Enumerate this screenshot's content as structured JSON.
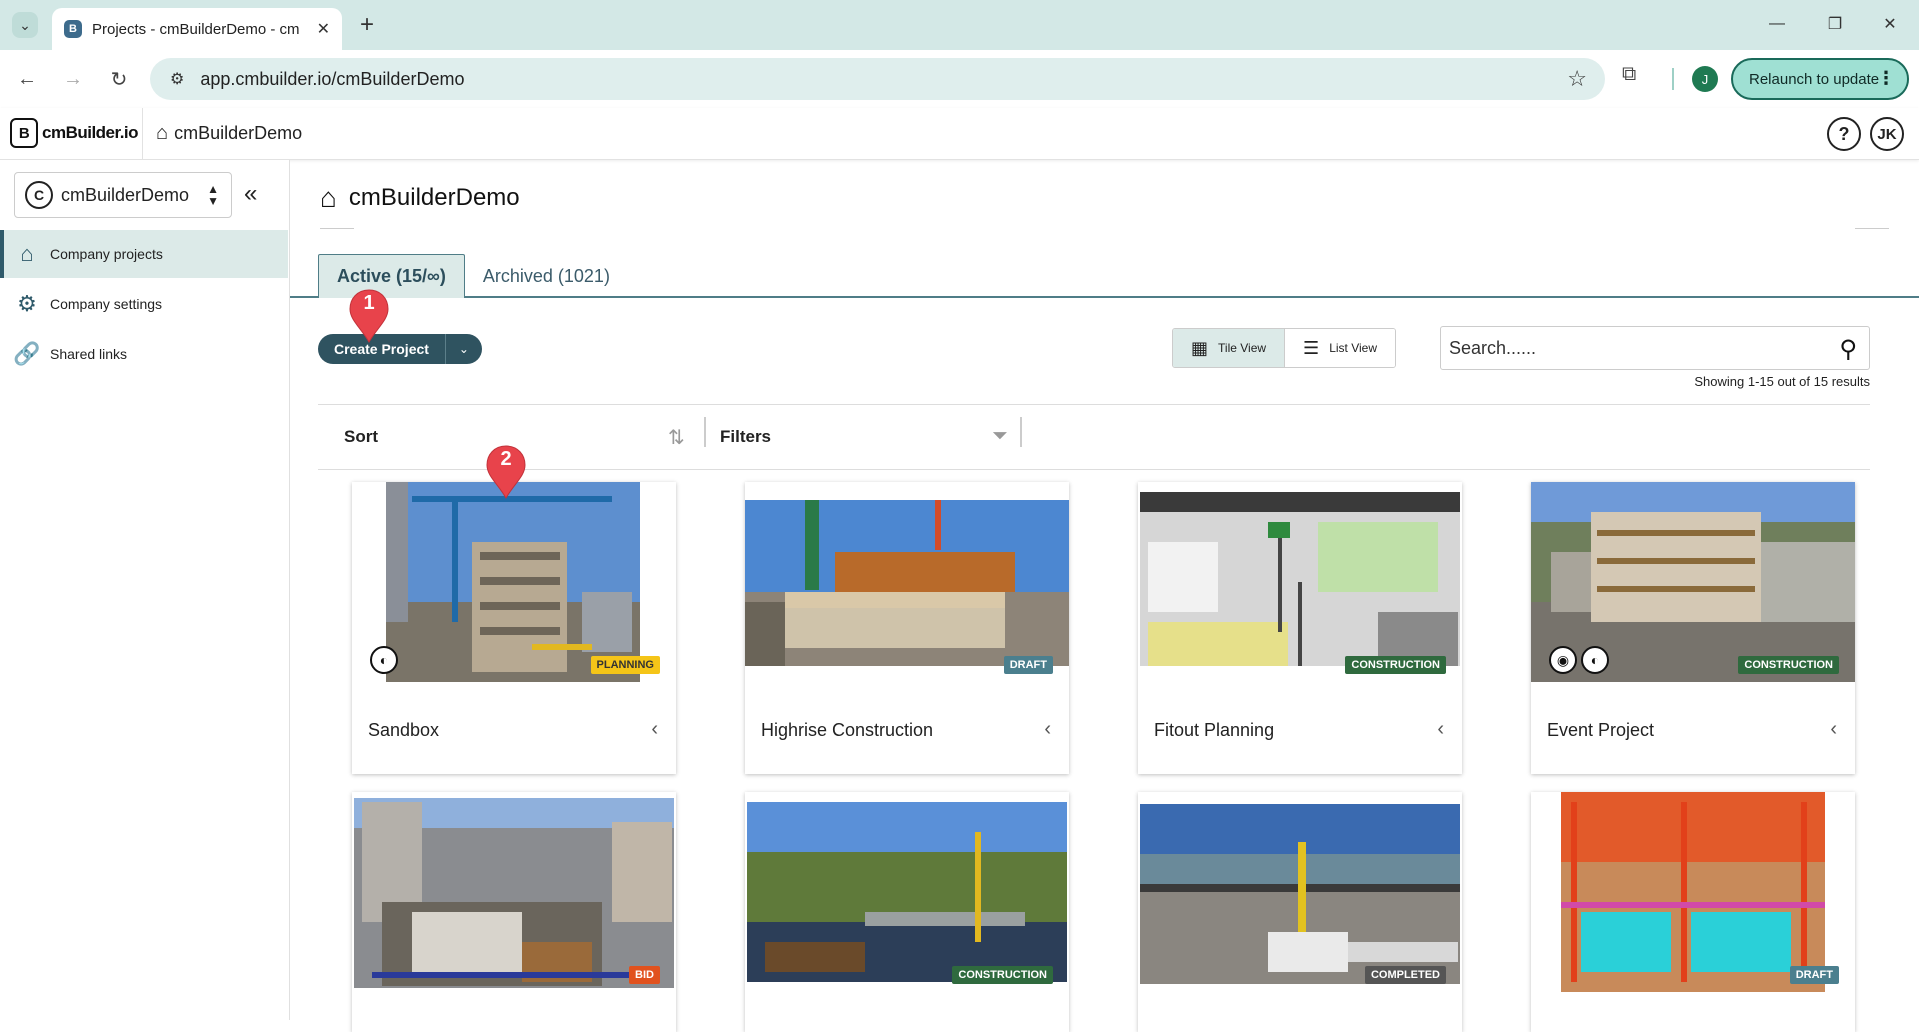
{
  "browser": {
    "tab_title": "Projects - cmBuilderDemo - cm",
    "tab_favicon": "B",
    "url": "app.cmbuilder.io/cmBuilderDemo",
    "profile_initial": "J",
    "relaunch_label": "Relaunch to update"
  },
  "header": {
    "logo_text": "cmBuilder.io",
    "logo_mark": "B",
    "breadcrumb": "cmBuilderDemo",
    "user_initials": "JK",
    "help": "?"
  },
  "sidebar": {
    "org_initial": "C",
    "org_name": "cmBuilderDemo",
    "items": [
      {
        "label": "Company projects",
        "icon": "home-icon",
        "active": true
      },
      {
        "label": "Company settings",
        "icon": "settings-icon",
        "active": false
      },
      {
        "label": "Shared links",
        "icon": "link-icon",
        "active": false
      }
    ]
  },
  "main": {
    "title": "cmBuilderDemo",
    "tabs": [
      {
        "label": "Active (15/∞)",
        "active": true
      },
      {
        "label": "Archived (1021)",
        "active": false
      }
    ],
    "create_button": "Create Project",
    "views": {
      "tile": "Tile View",
      "list": "List View"
    },
    "search_placeholder": "Search......",
    "results_text": "Showing 1-15 out of 15 results",
    "sort_label": "Sort",
    "filters_label": "Filters"
  },
  "projects": [
    {
      "name": "Sandbox",
      "status": "PLANNING"
    },
    {
      "name": "Highrise Construction",
      "status": "DRAFT"
    },
    {
      "name": "Fitout Planning",
      "status": "CONSTRUCTION"
    },
    {
      "name": "Event Project",
      "status": "CONSTRUCTION"
    },
    {
      "name": "",
      "status": "BID"
    },
    {
      "name": "",
      "status": "CONSTRUCTION"
    },
    {
      "name": "",
      "status": "COMPLETED"
    },
    {
      "name": "",
      "status": "DRAFT"
    }
  ],
  "callouts": [
    "1",
    "2"
  ],
  "colors": {
    "accent": "#2f5360",
    "active_tab_bg": "#dceae8",
    "planning": "#f5c518",
    "construction": "#2f6a3e",
    "bid": "#e1521e",
    "callout": "#e8434b"
  }
}
